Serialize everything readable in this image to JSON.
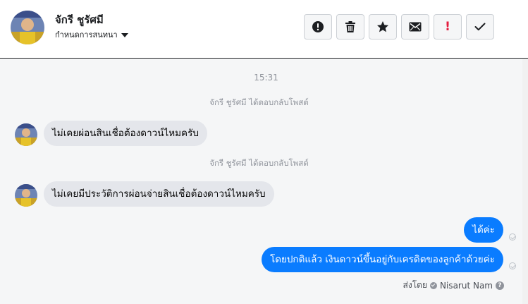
{
  "header": {
    "contact_name": "จักรี ชูรัศมี",
    "assign_label": "กำหนดการสนทนา",
    "toolbar": [
      {
        "name": "spam-button",
        "icon": "exclamation-circle-icon"
      },
      {
        "name": "delete-button",
        "icon": "trash-icon"
      },
      {
        "name": "star-button",
        "icon": "star-icon"
      },
      {
        "name": "mark-unread-button",
        "icon": "envelope-icon"
      },
      {
        "name": "follow-up-button",
        "icon": "red-exclamation-icon",
        "text": "!"
      },
      {
        "name": "mark-done-button",
        "icon": "check-icon"
      }
    ]
  },
  "thread": {
    "timestamp": "15:31",
    "system_notice_1": "จักรี ชูรัศมี ได้ตอบกลับโพสต์",
    "incoming_1": "ไม่เคยผ่อนสินเชื่อต้องดาวน์ไหมครับ",
    "system_notice_2": "จักรี ชูรัศมี ได้ตอบกลับโพสต์",
    "incoming_2": "ไม่เคยมีประวัติการผ่อนจ่ายสินเชื่อต้องดาวน์ไหมครับ",
    "outgoing_1": "ได้ค่ะ",
    "outgoing_2": "โดยปกติแล้ว เงินดาวน์ขึ้นอยู่กับเครดิตของลูกค้าด้วยค่ะ",
    "sent_by_label": "ส่งโดย",
    "sent_by_name": "Nisarut Nam",
    "help_glyph": "?"
  },
  "colors": {
    "outgoing_bubble": "#0a7cff",
    "incoming_bubble": "#e4e6eb",
    "follow_up_red": "#e41e3f"
  }
}
